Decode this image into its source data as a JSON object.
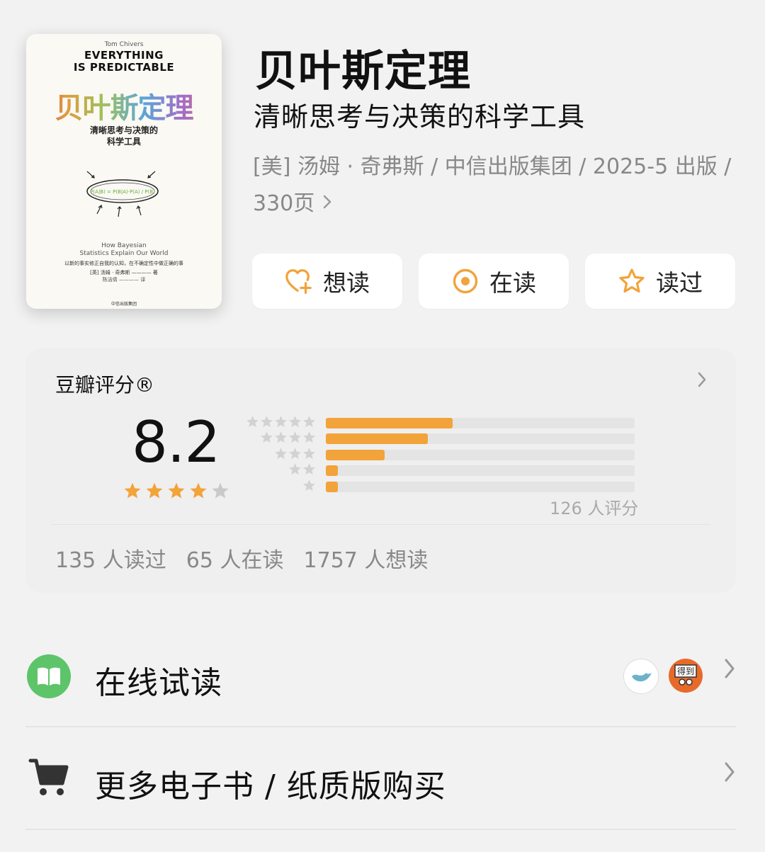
{
  "cover": {
    "author_en": "Tom Chivers",
    "title_en": "EVERYTHING\nIS PREDICTABLE",
    "title_zh": "贝叶斯定理",
    "subtitle_zh": "清晰思考与决策的\n科学工具",
    "formula": "P(A|B) = P(B|A)·P(A) / P(B)",
    "subtitle_en": "How Bayesian\nStatistics Explain Our World",
    "tagline": "以新的事实修正自我的认知，在不确定性中做正确的事",
    "author_zh": "[英] 汤姆 · 奇弗斯 ———— 著",
    "translator": "陈洁倩 ———— 译",
    "publisher": "中信出版集团"
  },
  "book": {
    "title": "贝叶斯定理",
    "subtitle": "清晰思考与决策的科学工具",
    "meta": "[美] 汤姆 · 奇弗斯 / 中信出版集团 / 2025-5 出版 / 330页"
  },
  "actions": {
    "want": "想读",
    "reading": "在读",
    "read": "读过"
  },
  "rating": {
    "heading": "豆瓣评分®",
    "score": "8.2",
    "stars": 4,
    "distribution": [
      {
        "stars": 5,
        "fraction": 0.41
      },
      {
        "stars": 4,
        "fraction": 0.33
      },
      {
        "stars": 3,
        "fraction": 0.19
      },
      {
        "stars": 2,
        "fraction": 0.04
      },
      {
        "stars": 1,
        "fraction": 0.04
      }
    ],
    "count": "126 人评分",
    "read_count": "135 人读过",
    "reading_count": "65 人在读",
    "want_count": "1757 人想读"
  },
  "list": {
    "trial_read": "在线试读",
    "trial_icon": "book-icon",
    "buy": "更多电子书 / 纸质版购买",
    "buy_icon": "cart-icon",
    "partner2_label": "得到"
  },
  "colors": {
    "accent": "#f2a33a",
    "bar_track": "#e4e4e4",
    "trial_green": "#5dc46a",
    "partner_orange": "#e86a2a"
  }
}
